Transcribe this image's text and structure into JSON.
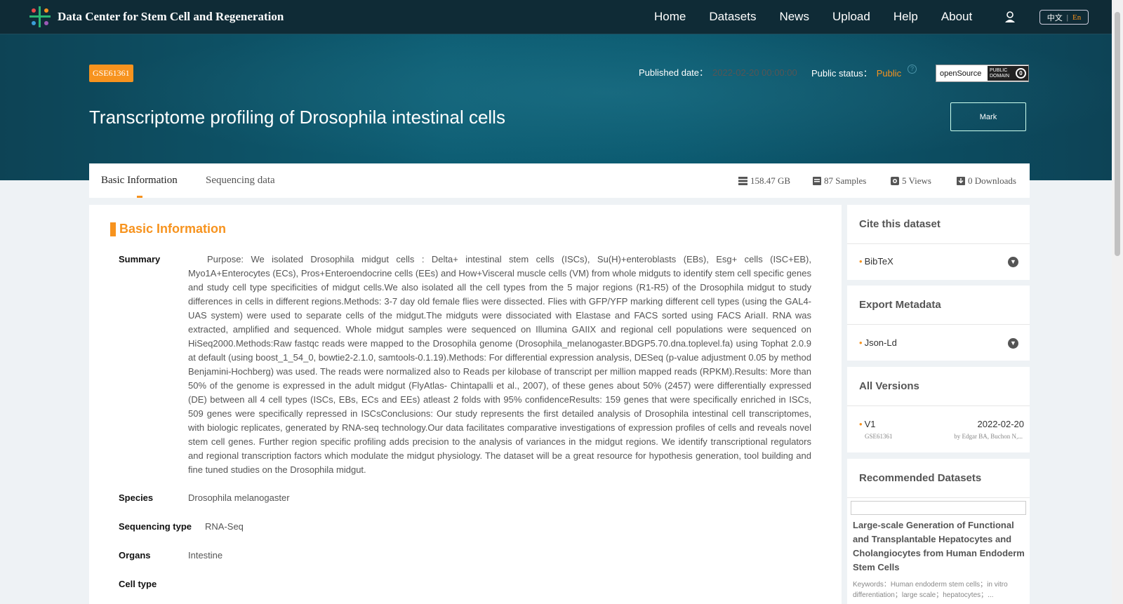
{
  "brand": {
    "title": "Data Center for Stem Cell and Regeneration"
  },
  "nav": {
    "items": [
      "Home",
      "Datasets",
      "News",
      "Upload",
      "Help",
      "About"
    ]
  },
  "lang": {
    "zh": "中文",
    "sep": "|",
    "en": "En"
  },
  "hero": {
    "accession": "GSE61361",
    "published_label": "Published date：",
    "published_value": "2022-02-20 00:00:00",
    "status_label": "Public status：",
    "status_value": "Public",
    "help": "?",
    "open_source": "openSource",
    "public_domain_line1": "PUBLIC",
    "public_domain_line2": "DOMAIN",
    "title": "Transcriptome profiling of Drosophila intestinal cells",
    "mark_label": "Mark"
  },
  "tabs": {
    "basic": "Basic Information",
    "sequencing": "Sequencing data"
  },
  "stats": {
    "size": "158.47 GB",
    "samples": "87 Samples",
    "views": "5 Views",
    "downloads": "0 Downloads"
  },
  "basic": {
    "heading": "Basic Information",
    "summary_label": "Summary",
    "summary": "Purpose: We isolated Drosophila midgut cells : Delta+ intestinal stem cells (ISCs), Su(H)+enteroblasts (EBs), Esg+ cells (ISC+EB), Myo1A+Enterocytes (ECs), Pros+Enteroendocrine cells (EEs) and How+Visceral muscle cells (VM) from whole midguts to identify stem cell specific genes and study cell type specificities of midgut cells.We also isolated all the cell types from the 5 major regions (R1-R5) of the Drosophila midgut to study differences in cells in different regions.Methods: 3-7 day old female flies were dissected. Flies with GFP/YFP marking different cell types (using the GAL4-UAS system) were used to separate cells of the midgut.The midguts were dissociated with Elastase and FACS sorted using FACS AriaII. RNA was extracted, amplified and sequenced. Whole midgut samples were sequenced on Illumina GAIIX and regional cell populations were sequenced on HiSeq2000.Methods:Raw fastqc reads were mapped to the Drosophila genome (Drosophila_melanogaster.BDGP5.70.dna.toplevel.fa) using Tophat 2.0.9 at default (using boost_1_54_0, bowtie2-2.1.0, samtools-0.1.19).Methods: For differential expression analysis, DESeq (p-value adjustment 0.05 by method Benjamini-Hochberg) was used. The reads were normalized also to Reads per kilobase of transcript per million mapped reads (RPKM).Results: More than 50% of the genome is expressed in the adult midgut (FlyAtlas- Chintapalli et al., 2007), of these genes about 50% (2457) were differentially expressed (DE) between all 4 cell types (ISCs, EBs, ECs and EEs) atleast 2 folds with 95% confidenceResults: 159 genes that were specifically enriched in ISCs, 509 genes were specifically repressed in ISCsConclusions: Our study represents the first detailed analysis of Drosophila intestinal cell transcriptomes, with biologic replicates, generated by RNA-seq technology.Our data facilitates comparative investigations of expression profiles of cells and reveals novel stem cell genes. Further region specific profiling adds precision to the analysis of variances in the midgut regions. We identify transcriptional regulators and regional transcription factors which modulate the midgut physiology. The dataset will be a great resource for hypothesis generation, tool building and fine tuned studies on the Drosophila midgut.",
    "species_label": "Species",
    "species": "Drosophila melanogaster",
    "seqtype_label": "Sequencing type",
    "seqtype": "RNA-Seq",
    "organs_label": "Organs",
    "organs": "Intestine",
    "celltype_label": "Cell type"
  },
  "cite": {
    "heading": "Cite this dataset",
    "item": "BibTeX"
  },
  "export": {
    "heading": "Export Metadata",
    "item": "Json-Ld"
  },
  "versions": {
    "heading": "All Versions",
    "version": "V1",
    "date": "2022-02-20",
    "accession": "GSE61361",
    "authors": "by Edgar BA, Buchon N,..."
  },
  "recommended": {
    "heading": "Recommended Datasets",
    "title": "Large-scale Generation of Functional and Transplantable Hepatocytes and Cholangiocytes from Human Endoderm Stem Cells",
    "keywords": "Keywords：Human endoderm stem cells；in vitro differentiation；large scale；hepatocytes；..."
  },
  "colors": {
    "accent": "#f7931e",
    "nav_bg": "#0f2b36",
    "hero": "#0d5d73"
  }
}
